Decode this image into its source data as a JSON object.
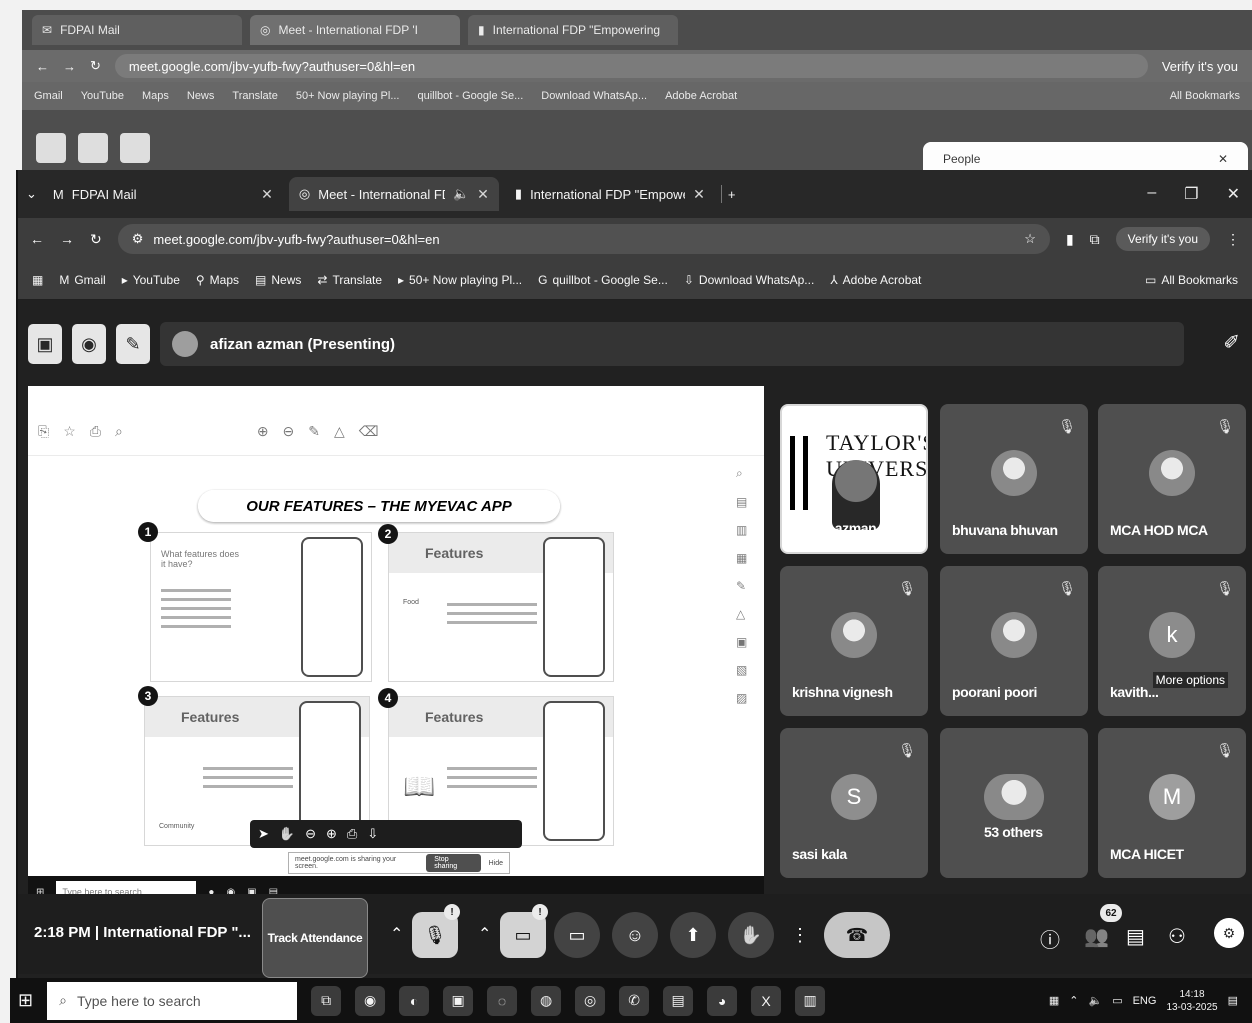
{
  "ghost": {
    "tabs": [
      "FDPAI Mail",
      "Meet - International FDP 'I",
      "International FDP \"Empowering"
    ],
    "url": "meet.google.com/jbv-yufb-fwy?authuser=0&hl=en",
    "verify": "Verify it's you",
    "bookmarks": [
      "Gmail",
      "YouTube",
      "Maps",
      "News",
      "Translate",
      "50+ Now playing Pl...",
      "quillbot - Google Se...",
      "Download WhatsAp...",
      "Adobe Acrobat"
    ],
    "all_bookmarks": "All Bookmarks",
    "people_panel": "People"
  },
  "browser": {
    "tabs": [
      {
        "title": "FDPAI Mail",
        "active": false
      },
      {
        "title": "Meet - International FDP 'I",
        "active": true
      },
      {
        "title": "International FDP \"Empowering",
        "active": false
      }
    ],
    "url": "meet.google.com/jbv-yufb-fwy?authuser=0&hl=en",
    "verify": "Verify it's you",
    "bookmarks": [
      "Gmail",
      "YouTube",
      "Maps",
      "News",
      "Translate",
      "50+ Now playing Pl...",
      "quillbot - Google Se...",
      "Download WhatsAp...",
      "Adobe Acrobat"
    ],
    "all_bookmarks": "All Bookmarks"
  },
  "meet": {
    "presenter_label": "afizan azman (Presenting)",
    "slide": {
      "title": "OUR FEATURES – THE MYEVAC APP",
      "panels": [
        {
          "num": "1",
          "heading": "What features does it have?"
        },
        {
          "num": "2",
          "heading": "Features",
          "sub": "Food"
        },
        {
          "num": "3",
          "heading": "Features",
          "sub": "Community"
        },
        {
          "num": "4",
          "heading": "Features"
        }
      ],
      "share_note": "meet.google.com is sharing your screen.",
      "stop_sharing": "Stop sharing",
      "hide": "Hide",
      "inner_search": "Type here to search"
    },
    "participants": [
      {
        "name": "afizan azman",
        "type": "taylor",
        "logo_text": "TAYLOR'S UNIVERSITY"
      },
      {
        "name": "bhuvana bhuvan",
        "type": "photo"
      },
      {
        "name": "MCA HOD MCA",
        "type": "photo"
      },
      {
        "name": "krishna vignesh",
        "type": "photo"
      },
      {
        "name": "poorani poori",
        "type": "photo"
      },
      {
        "name": "kavith...",
        "type": "letter",
        "letter": "k",
        "more_options": "More options"
      },
      {
        "name": "sasi kala",
        "type": "letter",
        "letter": "S"
      },
      {
        "name": "53 others",
        "type": "group"
      },
      {
        "name": "MCA HICET",
        "type": "letter",
        "letter": "M"
      }
    ],
    "controls": {
      "time": "2:18 PM",
      "meeting_title": "International FDP \"...",
      "track_attendance": "Track Attendance",
      "mic_badge": "!",
      "cam_badge": "!",
      "people_count": "62"
    }
  },
  "taskbar": {
    "search_placeholder": "Type here to search",
    "lang": "ENG",
    "time": "14:18",
    "date": "13-03-2025"
  }
}
